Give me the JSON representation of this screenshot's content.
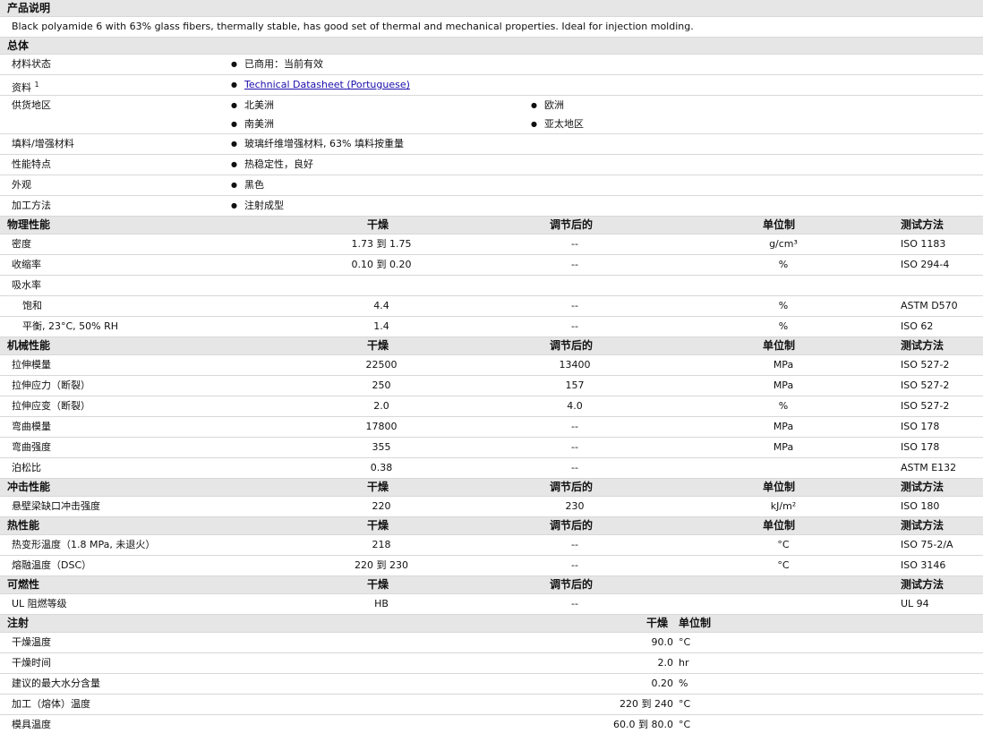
{
  "description": {
    "title": "产品说明",
    "text": "Black polyamide 6 with 63% glass fibers, thermally stable, has good set of thermal and mechanical properties. Ideal for injection molding."
  },
  "general": {
    "title": "总体",
    "rows": [
      {
        "label": "材料状态",
        "items": [
          "已商用：当前有效"
        ]
      },
      {
        "label": "资料",
        "sup": "1",
        "items": [
          "Technical Datasheet (Portuguese)"
        ]
      },
      {
        "label": "供货地区",
        "items": [
          "北美洲",
          "欧洲",
          "南美洲",
          "亚太地区"
        ]
      },
      {
        "label": "填料/增强材料",
        "items": [
          "玻璃纤维增强材料, 63% 填料按重量"
        ]
      },
      {
        "label": "性能特点",
        "items": [
          "热稳定性，良好"
        ]
      },
      {
        "label": "外观",
        "items": [
          "黑色"
        ]
      },
      {
        "label": "加工方法",
        "items": [
          "注射成型"
        ]
      }
    ]
  },
  "physical": {
    "title": "物理性能",
    "cols": [
      "干燥",
      "调节后的",
      "单位制",
      "测试方法"
    ],
    "rows": [
      {
        "name": "密度",
        "dry": "1.73 到  1.75",
        "cond": "--",
        "unit": "g/cm³",
        "method": "ISO 1183"
      },
      {
        "name": "收缩率",
        "dry": "0.10 到  0.20",
        "cond": "--",
        "unit": "%",
        "method": "ISO 294-4"
      },
      {
        "name": "吸水率",
        "dry": "",
        "cond": "",
        "unit": "",
        "method": ""
      },
      {
        "name": "饱和",
        "dry": "4.4",
        "cond": "--",
        "unit": "%",
        "method": "ASTM D570"
      },
      {
        "name": "平衡, 23°C, 50% RH",
        "dry": "1.4",
        "cond": "--",
        "unit": "%",
        "method": "ISO 62"
      }
    ]
  },
  "mechanical": {
    "title": "机械性能",
    "cols": [
      "干燥",
      "调节后的",
      "单位制",
      "测试方法"
    ],
    "rows": [
      {
        "name": "拉伸模量",
        "dry": "22500",
        "cond": "13400",
        "unit": "MPa",
        "method": "ISO 527-2"
      },
      {
        "name": "拉伸应力（断裂）",
        "dry": "250",
        "cond": "157",
        "unit": "MPa",
        "method": "ISO 527-2"
      },
      {
        "name": "拉伸应变（断裂）",
        "dry": "2.0",
        "cond": "4.0",
        "unit": "%",
        "method": "ISO 527-2"
      },
      {
        "name": "弯曲模量",
        "dry": "17800",
        "cond": "--",
        "unit": "MPa",
        "method": "ISO 178"
      },
      {
        "name": "弯曲强度",
        "dry": "355",
        "cond": "--",
        "unit": "MPa",
        "method": "ISO 178"
      },
      {
        "name": "泊松比",
        "dry": "0.38",
        "cond": "--",
        "unit": "",
        "method": "ASTM E132"
      }
    ]
  },
  "impact": {
    "title": "冲击性能",
    "cols": [
      "干燥",
      "调节后的",
      "单位制",
      "测试方法"
    ],
    "rows": [
      {
        "name": "悬壁梁缺口冲击强度",
        "dry": "220",
        "cond": "230",
        "unit": "kJ/m²",
        "method": "ISO 180"
      }
    ]
  },
  "thermal": {
    "title": "热性能",
    "cols": [
      "干燥",
      "调节后的",
      "单位制",
      "测试方法"
    ],
    "rows": [
      {
        "name": "热变形温度（1.8 MPa, 未退火）",
        "dry": "218",
        "cond": "--",
        "unit": "°C",
        "method": "ISO 75-2/A"
      },
      {
        "name": "熔融温度（DSC）",
        "dry": "220 到  230",
        "cond": "--",
        "unit": "°C",
        "method": "ISO 3146"
      }
    ]
  },
  "flammability": {
    "title": "可燃性",
    "cols": [
      "干燥",
      "调节后的",
      "测试方法"
    ],
    "rows": [
      {
        "name": "UL 阻燃等级",
        "dry": "HB",
        "cond": "--",
        "method": "UL 94"
      }
    ]
  },
  "injection": {
    "title": "注射",
    "cols": [
      "干燥",
      "单位制"
    ],
    "rows": [
      {
        "name": "干燥温度",
        "value": "90.0",
        "unit": "°C"
      },
      {
        "name": "干燥时间",
        "value": "2.0",
        "unit": "hr"
      },
      {
        "name": "建议的最大水分含量",
        "value": "0.20",
        "unit": "%"
      },
      {
        "name": "加工（熔体）温度",
        "value": "220 到  240",
        "unit": "°C"
      },
      {
        "name": "模具温度",
        "value": "60.0 到  80.0",
        "unit": "°C"
      }
    ]
  }
}
